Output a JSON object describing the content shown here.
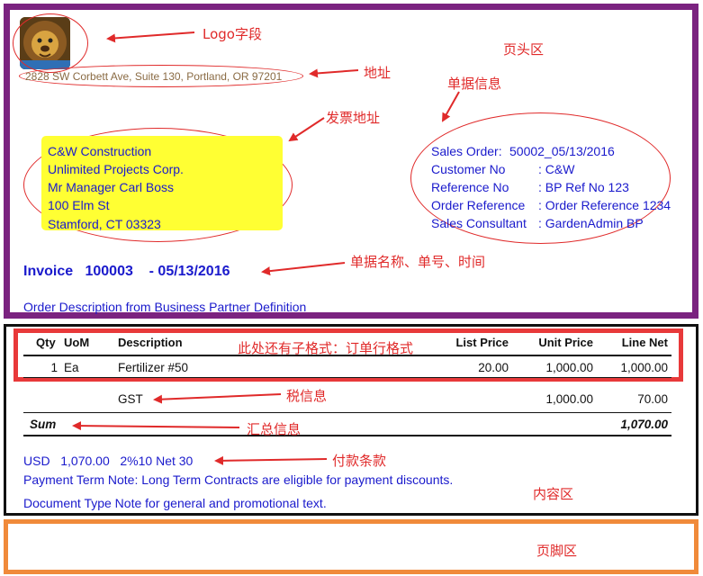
{
  "header": {
    "address": "2828 SW Corbett Ave, Suite 130, Portland, OR 97201",
    "bill_to": [
      "C&W Construction",
      "Unlimited Projects Corp.",
      "Mr Manager Carl Boss",
      "100 Elm St",
      "Stamford, CT 03323"
    ],
    "doc_info": [
      {
        "label": "Sales Order:",
        "value": "50002_05/13/2016"
      },
      {
        "label": "Customer No",
        "value": ": C&W"
      },
      {
        "label": "Reference No",
        "value": ": BP Ref No 123"
      },
      {
        "label": "Order Reference",
        "value": ": Order Reference 1234"
      },
      {
        "label": "Sales Consultant",
        "value": ": GardenAdmin BP"
      }
    ],
    "doc_title": "Invoice   100003    - 05/13/2016",
    "order_description": "Order Description from Business Partner Definition"
  },
  "table": {
    "headers": {
      "qty": "Qty",
      "uom": "UoM",
      "description": "Description",
      "list_price": "List Price",
      "unit_price": "Unit Price",
      "line_net": "Line Net"
    },
    "line": {
      "qty": "1",
      "uom": "Ea",
      "description": "Fertilizer #50",
      "list_price": "20.00",
      "unit_price": "1,000.00",
      "line_net": "1,000.00"
    },
    "tax": {
      "name": "GST",
      "base": "1,000.00",
      "amount": "70.00"
    },
    "sum": {
      "label": "Sum",
      "total": "1,070.00"
    }
  },
  "payment": {
    "line": "USD   1,070.00   2%10 Net 30",
    "term_note": "Payment Term Note: Long Term Contracts are eligible for payment discounts.",
    "doc_type_note": "Document Type Note for general and promotional text."
  },
  "annotations": {
    "logo": "Logo字段",
    "address": "地址",
    "header_area": "页头区",
    "doc_info": "单据信息",
    "bill_address": "发票地址",
    "title": "单据名称、单号、时间",
    "row_format": "此处还有子格式：订单行格式",
    "tax": "税信息",
    "sum": "汇总信息",
    "payment": "付款条款",
    "content_area": "内容区",
    "footer_area": "页脚区"
  },
  "colors": {
    "header_border": "#7b2380",
    "footer_border": "#f08a3a",
    "row_format_border": "#e8393a",
    "annotation": "#e02a2a",
    "text_blue": "#1a1acc",
    "bill_highlight": "#ffff33"
  }
}
